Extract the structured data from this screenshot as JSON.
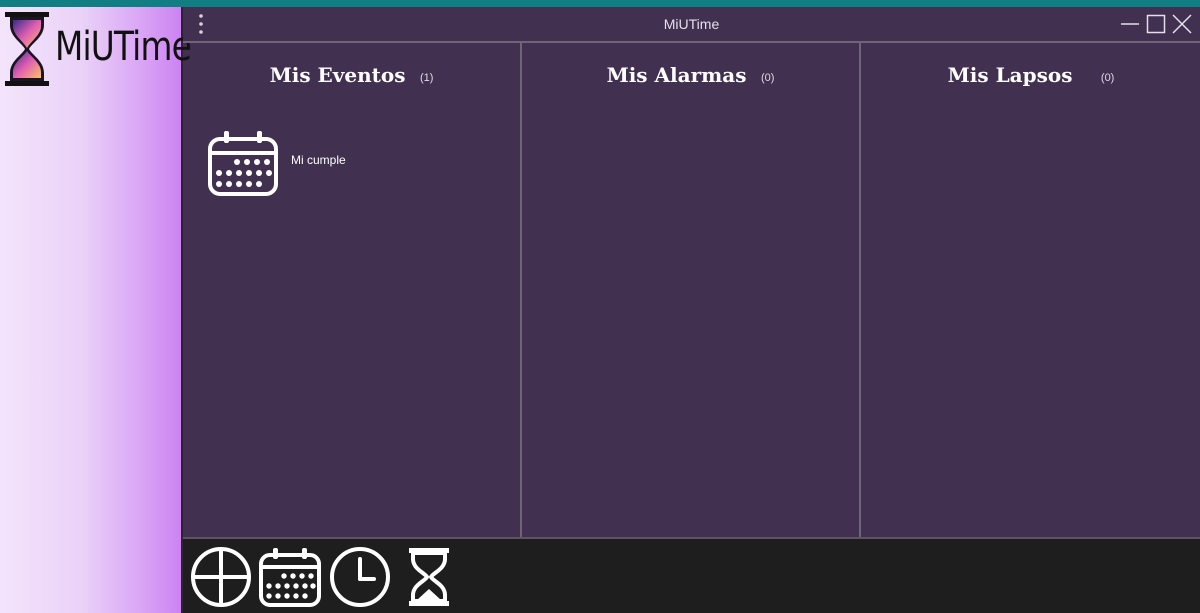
{
  "app": {
    "logo_text": "MiUTime",
    "window_title": "MiUTime"
  },
  "columns": [
    {
      "title": "Mis Eventos",
      "count": "(1)"
    },
    {
      "title": "Mis Alarmas",
      "count": "(0)"
    },
    {
      "title": "Mis Lapsos",
      "count": "(0)"
    }
  ],
  "events": [
    {
      "label": "Mi cumple",
      "icon": "calendar-icon"
    }
  ],
  "bottom_nav": [
    {
      "icon": "add-circle-icon"
    },
    {
      "icon": "calendar-icon"
    },
    {
      "icon": "clock-icon"
    },
    {
      "icon": "hourglass-icon"
    }
  ],
  "colors": {
    "accent_strip": "#117e84",
    "panel_bg": "#41304f",
    "bottom_bar": "#1e1e1e",
    "sidebar_gradient_end": "#cb83f1"
  }
}
